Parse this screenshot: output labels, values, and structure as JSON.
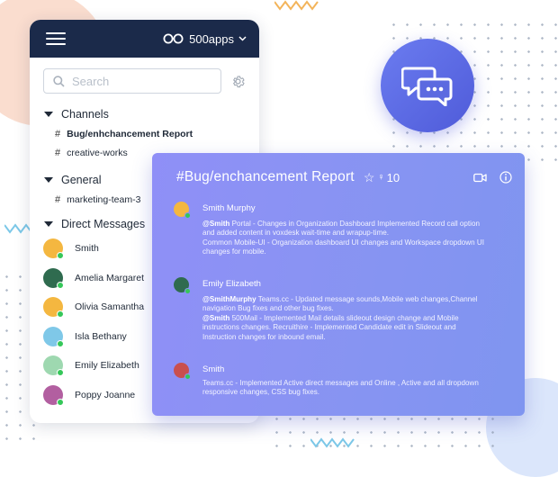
{
  "brand": {
    "name": "500apps"
  },
  "search": {
    "placeholder": "Search"
  },
  "sidebar": {
    "channels_label": "Channels",
    "channels": [
      {
        "label": "Bug/enhchancement Report",
        "active": true
      },
      {
        "label": "creative-works",
        "active": false
      }
    ],
    "general_label": "General",
    "general": [
      {
        "label": "marketing-team-3"
      }
    ],
    "dm_label": "Direct Messages",
    "direct_messages": [
      {
        "name": "Smith",
        "avatar_color": "#f4b740"
      },
      {
        "name": "Amelia Margaret",
        "avatar_color": "#2f6b4f"
      },
      {
        "name": "Olivia Samantha",
        "avatar_color": "#f4b740"
      },
      {
        "name": "Isla Bethany",
        "avatar_color": "#7fc8e8"
      },
      {
        "name": "Emily Elizabeth",
        "avatar_color": "#9ed8b0"
      },
      {
        "name": "Poppy Joanne",
        "avatar_color": "#b25fa0"
      }
    ]
  },
  "channel_panel": {
    "title": "#Bug/enchancement Report",
    "member_count": "10",
    "messages": [
      {
        "author": "Smith Murphy",
        "avatar_color": "#f4b740",
        "mention": "@Smith",
        "lines": [
          " Portal - Changes in Organization Dashboard Implemented Record call option",
          "and added content in voxdesk wait-time and wrapup-time.",
          "Common Mobile-UI - Organization dashboard UI changes and Workspace dropdown UI",
          "changes for mobile."
        ]
      },
      {
        "author": "Emily Elizabeth",
        "avatar_color": "#2f6b4f",
        "mention": "@SmithMurphy",
        "lines": [
          " Teams.cc - Updated message sounds,Mobile web changes,Channel",
          "navigation Bug fixes and other bug fixes."
        ],
        "mention2": "@Smith",
        "lines2": [
          " 500Mail - Implemented Mail details slideout design change and Mobile",
          "instructions changes. Recruithire - Implemented Candidate edit in Slideout and",
          "Instruction changes for inbound email."
        ]
      },
      {
        "author": "Smith",
        "avatar_color": "#c94f4f",
        "lines": [
          "Teams.cc - Implemented Active direct messages and Online , Active and all dropdown",
          "responsive changes, CSS bug fixes."
        ]
      }
    ]
  },
  "colors": {
    "header_bg": "#1b2a4a",
    "panel_gradient_start": "#8f8ff7",
    "panel_gradient_end": "#7f95f0",
    "online": "#35c759"
  }
}
